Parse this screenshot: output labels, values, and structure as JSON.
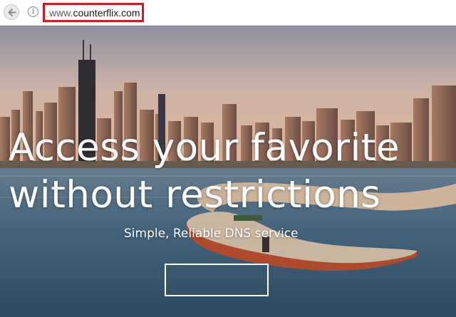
{
  "browser": {
    "url_prefix": "www.",
    "url_domain": "counterflix.com",
    "info_glyph": "i",
    "back_icon": "back-arrow-icon",
    "info_icon": "info-icon",
    "highlight_color": "#d01a1f"
  },
  "hero": {
    "headline_line1": "Access your favorite",
    "headline_line2": "without restrictions",
    "subheadline": "Simple, Reliable DNS service",
    "cta_label": ""
  }
}
